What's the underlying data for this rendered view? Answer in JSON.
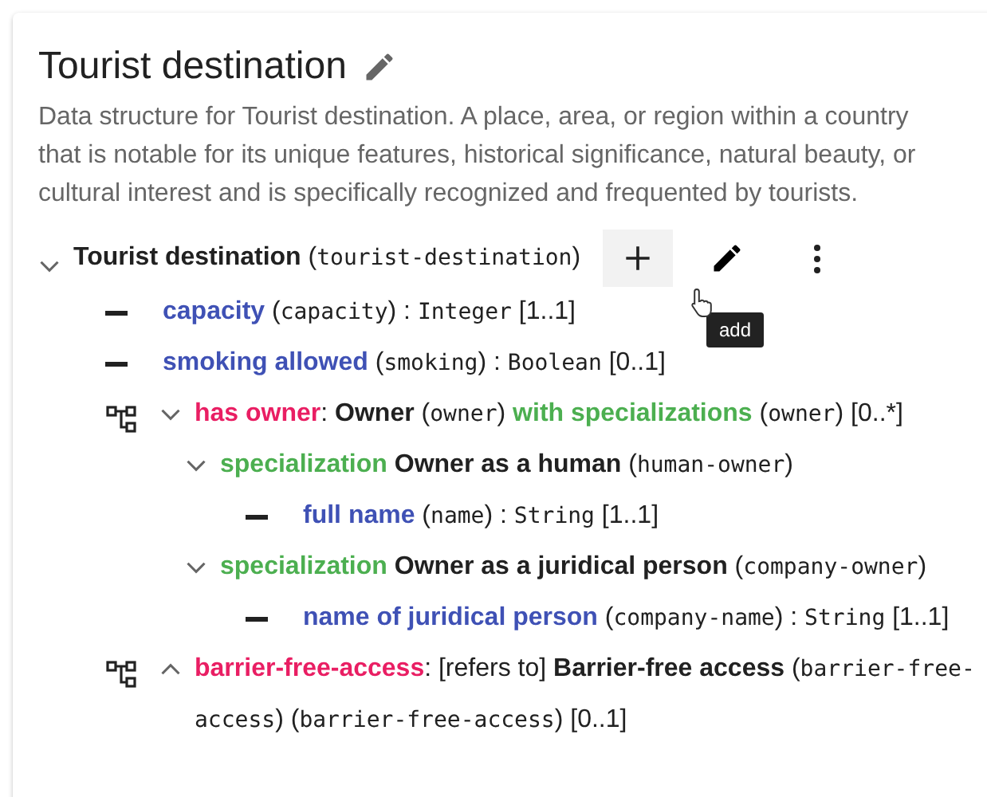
{
  "card": {
    "title": "Tourist destination",
    "description": "Data structure for Tourist destination. A place, area, or region within a country that is notable for its unique features, historical significance, natural beauty, or cultural interest and is specifically recognized and frequented by tourists."
  },
  "tree": {
    "kind": "root",
    "expanded": true,
    "parts": [
      {
        "kind": "class",
        "text": "Tourist destination"
      },
      {
        "kind": "plain",
        "text": " ("
      },
      {
        "kind": "mono",
        "text": "tourist-destination"
      },
      {
        "kind": "plain",
        "text": ")"
      }
    ],
    "actions": [
      {
        "kind": "add",
        "hovered": true,
        "tooltip": "add"
      },
      {
        "kind": "edit",
        "hovered": false
      },
      {
        "kind": "more",
        "hovered": false
      }
    ],
    "children": [
      {
        "kind": "attribute",
        "parts": [
          {
            "kind": "name",
            "text": "capacity"
          },
          {
            "kind": "plain",
            "text": " ("
          },
          {
            "kind": "mono",
            "text": "capacity"
          },
          {
            "kind": "plain",
            "text": ") : "
          },
          {
            "kind": "mono",
            "text": "Integer"
          },
          {
            "kind": "plain",
            "text": " [1..1]"
          }
        ]
      },
      {
        "kind": "attribute",
        "parts": [
          {
            "kind": "name",
            "text": "smoking allowed"
          },
          {
            "kind": "plain",
            "text": " ("
          },
          {
            "kind": "mono",
            "text": "smoking"
          },
          {
            "kind": "plain",
            "text": ") : "
          },
          {
            "kind": "mono",
            "text": "Boolean"
          },
          {
            "kind": "plain",
            "text": " [0..1]"
          }
        ]
      },
      {
        "kind": "association",
        "expanded": true,
        "parts": [
          {
            "kind": "role",
            "text": "has owner"
          },
          {
            "kind": "plain",
            "text": ": "
          },
          {
            "kind": "class",
            "text": "Owner"
          },
          {
            "kind": "plain",
            "text": " ("
          },
          {
            "kind": "mono",
            "text": "owner"
          },
          {
            "kind": "plain",
            "text": ") "
          },
          {
            "kind": "spec",
            "text": "with specializations"
          },
          {
            "kind": "plain",
            "text": " ("
          },
          {
            "kind": "mono",
            "text": "owner"
          },
          {
            "kind": "plain",
            "text": ") [0..*]"
          }
        ],
        "children": [
          {
            "kind": "specialization",
            "expanded": true,
            "parts": [
              {
                "kind": "spec",
                "text": "specialization"
              },
              {
                "kind": "class",
                "text": "Owner as a human"
              },
              {
                "kind": "plain",
                "text": " ("
              },
              {
                "kind": "mono",
                "text": "human-owner"
              },
              {
                "kind": "plain",
                "text": ")"
              }
            ],
            "children": [
              {
                "kind": "attribute",
                "parts": [
                  {
                    "kind": "name",
                    "text": "full name"
                  },
                  {
                    "kind": "plain",
                    "text": " ("
                  },
                  {
                    "kind": "mono",
                    "text": "name"
                  },
                  {
                    "kind": "plain",
                    "text": ") : "
                  },
                  {
                    "kind": "mono",
                    "text": "String"
                  },
                  {
                    "kind": "plain",
                    "text": " [1..1]"
                  }
                ]
              }
            ]
          },
          {
            "kind": "specialization",
            "expanded": true,
            "parts": [
              {
                "kind": "spec",
                "text": "specialization"
              },
              {
                "kind": "class",
                "text": "Owner as a juridical person"
              },
              {
                "kind": "plain",
                "text": " ("
              },
              {
                "kind": "mono",
                "text": "company-owner"
              },
              {
                "kind": "plain",
                "text": ")"
              }
            ],
            "children": [
              {
                "kind": "attribute",
                "parts": [
                  {
                    "kind": "name",
                    "text": "name of juridical person"
                  },
                  {
                    "kind": "plain",
                    "text": " ("
                  },
                  {
                    "kind": "mono",
                    "text": "company-name"
                  },
                  {
                    "kind": "plain",
                    "text": ") : "
                  },
                  {
                    "kind": "mono",
                    "text": "String"
                  },
                  {
                    "kind": "plain",
                    "text": " [1..1]"
                  }
                ]
              }
            ]
          }
        ]
      },
      {
        "kind": "association",
        "expanded": false,
        "parts": [
          {
            "kind": "role",
            "text": "barrier-free-access"
          },
          {
            "kind": "plain",
            "text": ": [refers to] "
          },
          {
            "kind": "class",
            "text": "Barrier-free access"
          },
          {
            "kind": "plain",
            "text": " ("
          },
          {
            "kind": "mono",
            "text": "barrier-free-access"
          },
          {
            "kind": "plain",
            "text": ") ("
          },
          {
            "kind": "mono",
            "text": "barrier-free-access"
          },
          {
            "kind": "plain",
            "text": ") [0..1]"
          }
        ]
      }
    ]
  }
}
